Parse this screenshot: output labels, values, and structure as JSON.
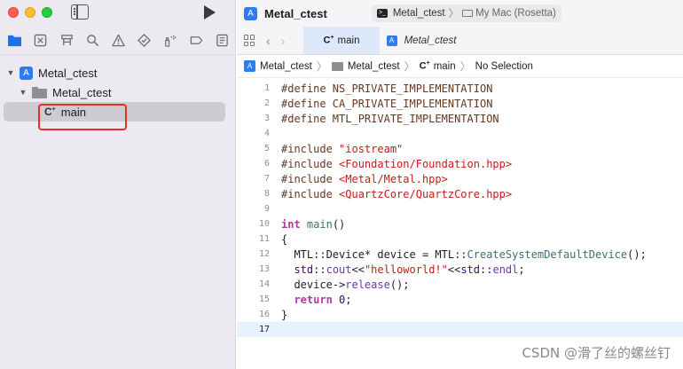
{
  "window": {
    "title": "Metal_ctest",
    "scheme_target": "Metal_ctest",
    "scheme_destination": "My Mac (Rosetta)"
  },
  "navigator": {
    "icons": [
      "folder-icon",
      "source-control-icon",
      "symbol-icon",
      "find-icon",
      "issue-icon",
      "test-icon",
      "debug-icon",
      "breakpoint-icon",
      "report-icon"
    ],
    "tree": [
      {
        "label": "Metal_ctest",
        "type": "project",
        "expanded": true
      },
      {
        "label": "Metal_ctest",
        "type": "group",
        "expanded": true
      },
      {
        "label": "main",
        "type": "file",
        "selected": true
      }
    ]
  },
  "tabs": [
    {
      "label": "main",
      "active": true
    },
    {
      "label": "Metal_ctest",
      "active": false
    }
  ],
  "jumpbar": {
    "project": "Metal_ctest",
    "group": "Metal_ctest",
    "file": "main",
    "selection": "No Selection"
  },
  "code": {
    "current_line": 17,
    "lines": [
      {
        "n": "1",
        "tokens": [
          [
            "pp",
            "#define NS_PRIVATE_IMPLEMENTATION"
          ]
        ]
      },
      {
        "n": "2",
        "tokens": [
          [
            "pp",
            "#define CA_PRIVATE_IMPLEMENTATION"
          ]
        ]
      },
      {
        "n": "3",
        "tokens": [
          [
            "pp",
            "#define MTL_PRIVATE_IMPLEMENTATION"
          ]
        ]
      },
      {
        "n": "4",
        "tokens": []
      },
      {
        "n": "5",
        "tokens": [
          [
            "pp",
            "#include "
          ],
          [
            "str",
            "\"iostream\""
          ]
        ]
      },
      {
        "n": "6",
        "tokens": [
          [
            "pp",
            "#include "
          ],
          [
            "str",
            "<Foundation/Foundation.hpp>"
          ]
        ]
      },
      {
        "n": "7",
        "tokens": [
          [
            "pp",
            "#include "
          ],
          [
            "str",
            "<Metal/Metal.hpp>"
          ]
        ]
      },
      {
        "n": "8",
        "tokens": [
          [
            "pp",
            "#include "
          ],
          [
            "str",
            "<QuartzCore/QuartzCore.hpp>"
          ]
        ]
      },
      {
        "n": "9",
        "tokens": []
      },
      {
        "n": "10",
        "tokens": [
          [
            "kw",
            "int"
          ],
          [
            "plain",
            " "
          ],
          [
            "fn",
            "main"
          ],
          [
            "plain",
            "()"
          ]
        ]
      },
      {
        "n": "11",
        "tokens": [
          [
            "plain",
            "{"
          ]
        ]
      },
      {
        "n": "12",
        "tokens": [
          [
            "plain",
            "  MTL::Device* device = MTL::"
          ],
          [
            "fn",
            "CreateSystemDefaultDevice"
          ],
          [
            "plain",
            "();"
          ]
        ]
      },
      {
        "n": "13",
        "tokens": [
          [
            "plain",
            "  "
          ],
          [
            "typ",
            "std"
          ],
          [
            "plain",
            "::"
          ],
          [
            "mem",
            "cout"
          ],
          [
            "plain",
            "<<"
          ],
          [
            "str",
            "\"helloworld!\""
          ],
          [
            "plain",
            "<<"
          ],
          [
            "typ",
            "std"
          ],
          [
            "plain",
            "::"
          ],
          [
            "mem",
            "endl"
          ],
          [
            "plain",
            ";"
          ]
        ]
      },
      {
        "n": "14",
        "tokens": [
          [
            "plain",
            "  device->"
          ],
          [
            "mem",
            "release"
          ],
          [
            "plain",
            "();"
          ]
        ]
      },
      {
        "n": "15",
        "tokens": [
          [
            "plain",
            "  "
          ],
          [
            "kw",
            "return"
          ],
          [
            "plain",
            " "
          ],
          [
            "num",
            "0"
          ],
          [
            "plain",
            ";"
          ]
        ]
      },
      {
        "n": "16",
        "tokens": [
          [
            "plain",
            "}"
          ]
        ]
      },
      {
        "n": "17",
        "tokens": []
      }
    ]
  },
  "watermark": "CSDN @滑了丝的螺丝钉",
  "colors": {
    "highlight_box": "#e0312b",
    "accent": "#2f7bf5"
  }
}
